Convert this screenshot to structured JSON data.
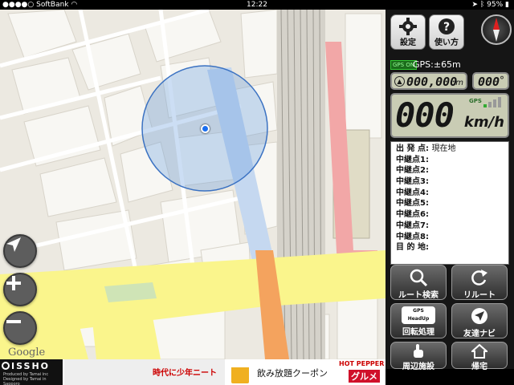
{
  "status_bar": {
    "carrier": "SoftBank",
    "time": "12:22",
    "battery": "95%"
  },
  "map": {
    "attribution": "Google",
    "accuracy_circle_color": "#6ea0e0"
  },
  "panel": {
    "settings_label": "設定",
    "help_label": "使い方",
    "gps_badge": "GPS ON",
    "gps_accuracy": "GPS:±65m",
    "distance": "000,000",
    "distance_unit": "m",
    "heading": "000",
    "heading_unit": "°",
    "speed": "000",
    "speed_unit": "km/h",
    "gps_small": "GPS",
    "waypoints": [
      {
        "label": "出 発 点:",
        "value": "現在地"
      },
      {
        "label": "中継点1:",
        "value": ""
      },
      {
        "label": "中継点2:",
        "value": ""
      },
      {
        "label": "中継点3:",
        "value": ""
      },
      {
        "label": "中継点4:",
        "value": ""
      },
      {
        "label": "中継点5:",
        "value": ""
      },
      {
        "label": "中継点6:",
        "value": ""
      },
      {
        "label": "中継点7:",
        "value": ""
      },
      {
        "label": "中継点8:",
        "value": ""
      },
      {
        "label": "目 的 地:",
        "value": ""
      }
    ],
    "buttons": {
      "route_search": "ルート検索",
      "reroute": "リルート",
      "rotate": "回転処理",
      "gps_headup": "GPS HeadUp",
      "friend_navi": "友達ナビ",
      "nearby": "周辺施設",
      "home": "帰宅"
    }
  },
  "ad": {
    "brand": "ISSHO",
    "brand_sub": "Produced by Tamai inc",
    "brand_sub2": "Designed by Tamai in Sapporo",
    "manga_text": "時代に少年ニート",
    "coupon": "飲み放題クーポン",
    "hotpepper": "HOT PEPPER",
    "gourmet": "グルメ"
  }
}
